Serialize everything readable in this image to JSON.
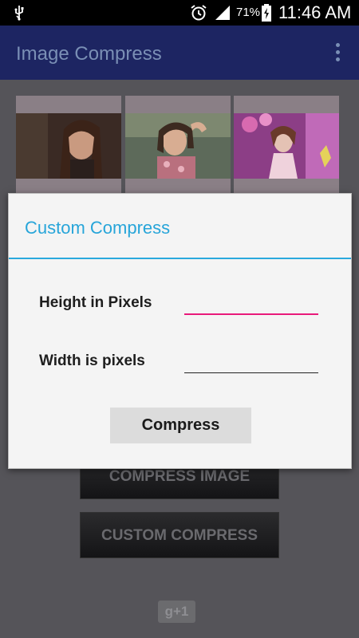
{
  "status_bar": {
    "battery_percent": "71%",
    "time": "11:46 AM",
    "icons": [
      "usb-icon",
      "alarm-icon",
      "signal-icon",
      "battery-charging-icon"
    ]
  },
  "app_bar": {
    "title": "Image Compress",
    "menu_icon": "overflow-menu-icon"
  },
  "background": {
    "compress_image_label": "COMPRESS IMAGE",
    "custom_compress_label": "CUSTOM COMPRESS",
    "gplus_label": "g+1"
  },
  "dialog": {
    "title": "Custom Compress",
    "height_label": "Height in Pixels",
    "height_value": "",
    "width_label": "Width is pixels",
    "width_value": "",
    "compress_button": "Compress"
  },
  "colors": {
    "accent": "#27a5d9",
    "focus_underline": "#e8197a",
    "action_bar": "#1d2562"
  }
}
